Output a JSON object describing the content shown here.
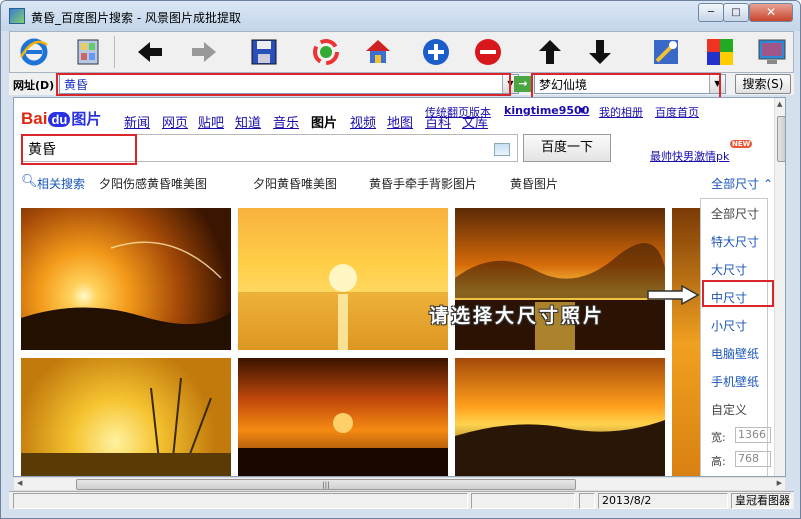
{
  "window": {
    "title": "黄昏_百度图片搜索 - 风景图片成批提取",
    "min": "─",
    "max": "□",
    "close": "✕"
  },
  "toolbar": {
    "icons": [
      "ie-icon",
      "album-icon",
      "back-icon",
      "forward-icon",
      "save-icon",
      "refresh-icon",
      "home-icon",
      "add-icon",
      "remove-icon",
      "upload-icon",
      "download-icon",
      "tools-icon",
      "palette-icon",
      "monitor-icon"
    ]
  },
  "address": {
    "label": "网址(D)",
    "value": "黄昏",
    "effect": "梦幻仙境",
    "search": "搜索(S)",
    "go": "→"
  },
  "baidu": {
    "logo_bai": "Bai",
    "logo_du": "du",
    "logo_pic": "图片",
    "nav": [
      "新闻",
      "网页",
      "贴吧",
      "知道",
      "音乐",
      "图片",
      "视频",
      "地图",
      "百科",
      "文库"
    ],
    "top_links": [
      "传统翻页版本",
      "kingtime9500",
      "我的相册",
      "百度首页"
    ],
    "query": "黄昏",
    "submit": "百度一下",
    "promo": "最帅快男激情pk",
    "promo_badge": "NEW",
    "related_label": "相关搜索",
    "related": [
      "夕阳伤感黄昏唯美图",
      "夕阳黄昏唯美图",
      "黄昏手牵手背影图片",
      "黄昏图片"
    ],
    "size_toggle": "全部尺寸 ⌃",
    "size_menu": [
      "全部尺寸",
      "特大尺寸",
      "大尺寸",
      "中尺寸",
      "小尺寸",
      "电脑壁纸",
      "手机壁纸",
      "自定义"
    ],
    "width_label": "宽:",
    "width_value": "1366",
    "height_label": "高:",
    "height_value": "768"
  },
  "annotation": "请选择大尺寸照片",
  "status": {
    "date": "2013/8/2",
    "app": "皇冠看图器"
  }
}
